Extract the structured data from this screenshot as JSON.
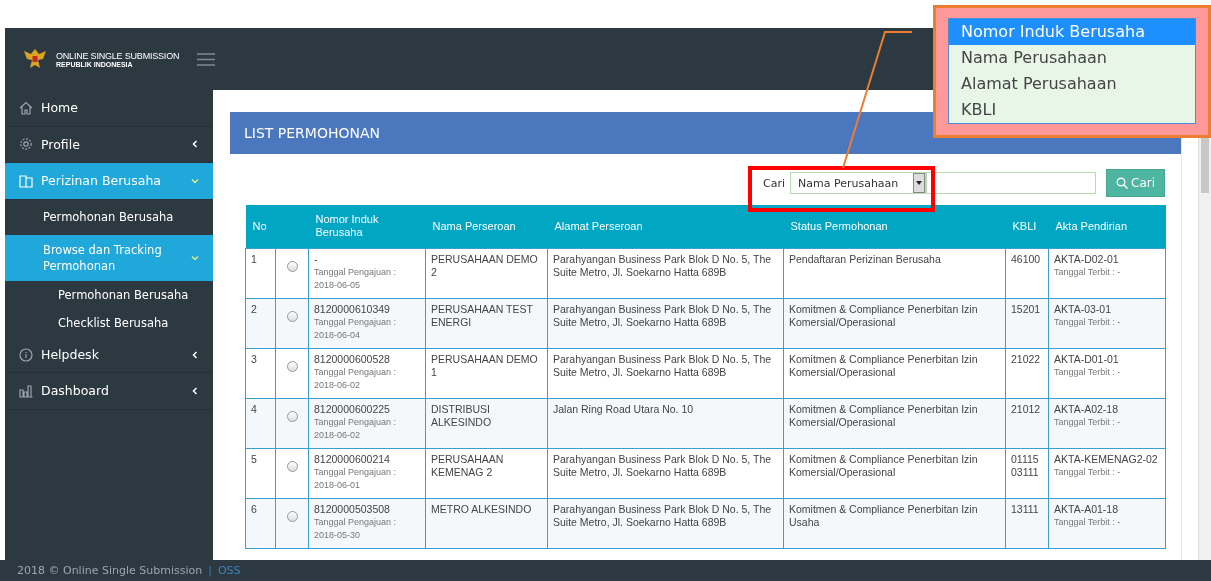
{
  "header": {
    "title": "ONLINE SINGLE SUBMISSION",
    "subtitle": "REPUBLIK INDONESIA"
  },
  "sidebar": {
    "items": [
      {
        "label": "Home",
        "selected": false
      },
      {
        "label": "Profile",
        "selected": false,
        "expanded": false
      },
      {
        "label": "Perizinan Berusaha",
        "selected": true,
        "expanded": true,
        "children": [
          {
            "label": "Permohonan Berusaha",
            "selected": false
          },
          {
            "label": "Browse dan Tracking Permohonan",
            "selected": true,
            "expanded": true,
            "children": [
              {
                "label": "Permohonan Berusaha",
                "selected": false
              },
              {
                "label": "Checklist Berusaha",
                "selected": false
              }
            ]
          }
        ]
      },
      {
        "label": "Helpdesk",
        "selected": false,
        "expanded": false
      },
      {
        "label": "Dashboard",
        "selected": false,
        "expanded": false
      }
    ]
  },
  "panel": {
    "title": "LIST PERMOHONAN"
  },
  "search": {
    "label": "Cari",
    "select_value": "Nama Perusahaan",
    "button": "Cari"
  },
  "dropdown_options": [
    {
      "label": "Nomor Induk Berusaha",
      "selected": true
    },
    {
      "label": "Nama Perusahaan",
      "selected": false
    },
    {
      "label": "Alamat Perusahaan",
      "selected": false
    },
    {
      "label": "KBLI",
      "selected": false
    }
  ],
  "table": {
    "columns": [
      "No",
      "Nomor Induk Berusaha",
      "Nama Perseroan",
      "Alamat Perseroan",
      "Status Permohonan",
      "KBLI",
      "Akta Pendirian"
    ],
    "rows": [
      {
        "no": "1",
        "selected": false,
        "nib": "-",
        "submitted": "Tanggal Pengajuan : 2018-06-05",
        "name": "PERUSAHAAN DEMO 2",
        "address": "Parahyangan Business Park Blok D No. 5, The Suite Metro, Jl. Soekarno Hatta 689B",
        "status": "Pendaftaran Perizinan Berusaha",
        "kbli": "46100",
        "akta": "AKTA-D02-01",
        "akta_date": "Tanggal Terbit : -"
      },
      {
        "no": "2",
        "selected": false,
        "nib": "8120000610349",
        "submitted": "Tanggal Pengajuan : 2018-06-04",
        "name": "PERUSAHAAN TEST ENERGI",
        "address": "Parahyangan Business Park Blok D No. 5, The Suite Metro, Jl. Soekarno Hatta 689B",
        "status": "Komitmen & Compliance Penerbitan Izin Komersial/Operasional",
        "kbli": "15201",
        "akta": "AKTA-03-01",
        "akta_date": "Tanggal Terbit : -"
      },
      {
        "no": "3",
        "selected": false,
        "nib": "8120000600528",
        "submitted": "Tanggal Pengajuan : 2018-06-02",
        "name": "PERUSAHAAN DEMO 1",
        "address": "Parahyangan Business Park Blok D No. 5, The Suite Metro, Jl. Soekarno Hatta 689B",
        "status": "Komitmen & Compliance Penerbitan Izin Komersial/Operasional",
        "kbli": "21022",
        "akta": "AKTA-D01-01",
        "akta_date": "Tanggal Terbit : -"
      },
      {
        "no": "4",
        "selected": false,
        "nib": "8120000600225",
        "submitted": "Tanggal Pengajuan : 2018-06-02",
        "name": "DISTRIBUSI ALKESINDO",
        "address": "Jalan Ring Road Utara No. 10",
        "status": "Komitmen & Compliance Penerbitan Izin Komersial/Operasional",
        "kbli": "21012",
        "akta": "AKTA-A02-18",
        "akta_date": "Tanggal Terbit : -"
      },
      {
        "no": "5",
        "selected": false,
        "nib": "8120000600214",
        "submitted": "Tanggal Pengajuan : 2018-06-01",
        "name": "PERUSAHAAN KEMENAG 2",
        "address": "Parahyangan Business Park Blok D No. 5, The Suite Metro, Jl. Soekarno Hatta 689B",
        "status": "Komitmen & Compliance Penerbitan Izin Komersial/Operasional",
        "kbli": "01115 03111",
        "akta": "AKTA-KEMENAG2-02",
        "akta_date": "Tanggal Terbit : -"
      },
      {
        "no": "6",
        "selected": false,
        "nib": "8120000503508",
        "submitted": "Tanggal Pengajuan : 2018-05-30",
        "name": "METRO ALKESINDO",
        "address": "Parahyangan Business Park Blok D No. 5, The Suite Metro, Jl. Soekarno Hatta 689B",
        "status": "Komitmen & Compliance Penerbitan Izin Usaha",
        "kbli": "13111",
        "akta": "AKTA-A01-18",
        "akta_date": "Tanggal Terbit : -"
      }
    ]
  },
  "footer": {
    "text": "2018 © Online Single Submission",
    "separator": "|",
    "link": "OSS"
  }
}
